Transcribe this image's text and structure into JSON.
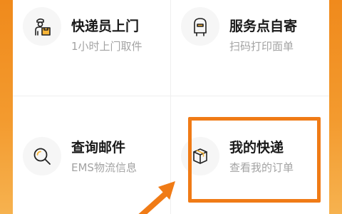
{
  "services": [
    {
      "title": "快递员上门",
      "subtitle": "1小时上门取件",
      "icon": "courier-icon"
    },
    {
      "title": "服务点自寄",
      "subtitle": "扫码打印面单",
      "icon": "parcel-locker-icon"
    },
    {
      "title": "查询邮件",
      "subtitle": "EMS物流信息",
      "icon": "search-icon"
    },
    {
      "title": "我的快递",
      "subtitle": "查看我的订单",
      "icon": "package-box-icon"
    }
  ],
  "colors": {
    "accent": "#f07b16",
    "background": "#f39a2e",
    "title_text": "#1a1a1a",
    "subtitle_text": "#a3a3a3"
  },
  "highlighted_item": "我的快递"
}
